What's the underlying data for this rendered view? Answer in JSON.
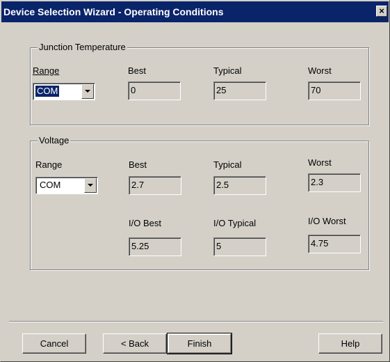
{
  "window": {
    "title": "Device Selection Wizard - Operating Conditions",
    "close_glyph": "×"
  },
  "junction": {
    "legend": "Junction Temperature",
    "range_label": "Range",
    "range_value": "COM",
    "best_label": "Best",
    "best_value": "0",
    "typical_label": "Typical",
    "typical_value": "25",
    "worst_label": "Worst",
    "worst_value": "70"
  },
  "voltage": {
    "legend": "Voltage",
    "range_label": "Range",
    "range_value": "COM",
    "best_label": "Best",
    "best_value": "2.7",
    "typical_label": "Typical",
    "typical_value": "2.5",
    "worst_label": "Worst",
    "worst_value": "2.3",
    "io_best_label": "I/O Best",
    "io_best_value": "5.25",
    "io_typical_label": "I/O Typical",
    "io_typical_value": "5",
    "io_worst_label": "I/O Worst",
    "io_worst_value": "4.75"
  },
  "buttons": {
    "cancel": "Cancel",
    "back": "< Back",
    "finish": "Finish",
    "help": "Help"
  },
  "colors": {
    "titlebar": "#0a246a",
    "face": "#d4d0c8"
  }
}
